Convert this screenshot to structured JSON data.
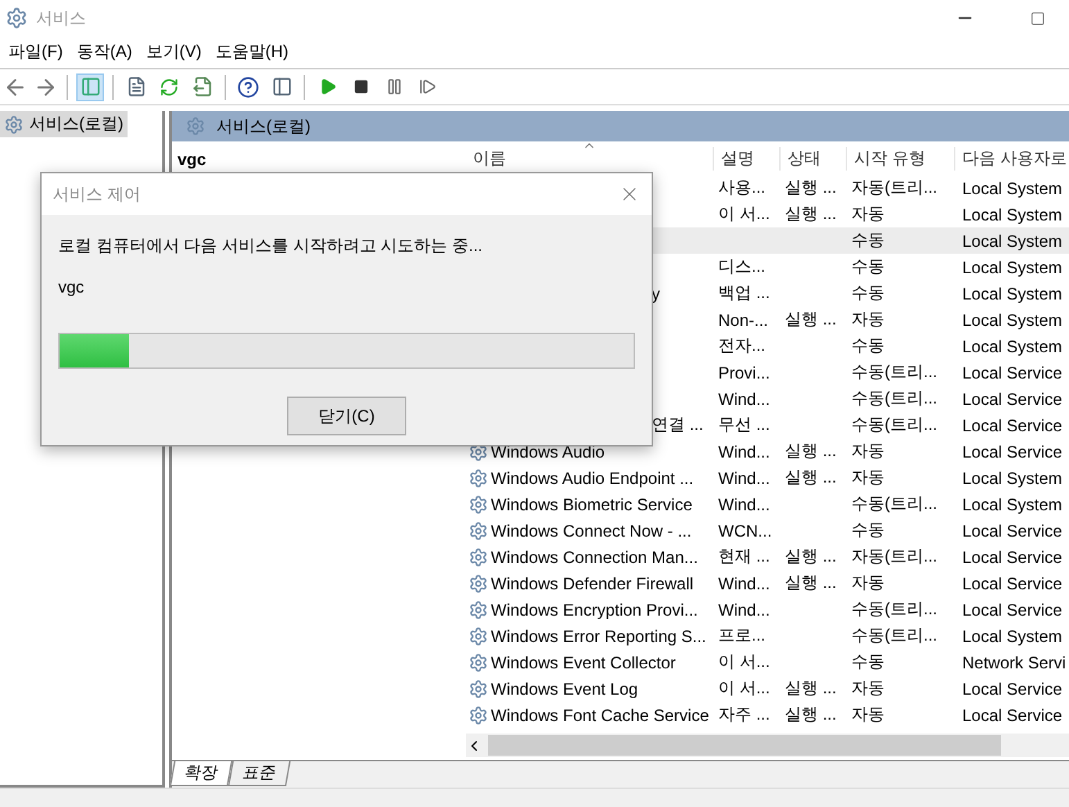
{
  "window": {
    "title": "서비스"
  },
  "menu": [
    "파일(F)",
    "동작(A)",
    "보기(V)",
    "도움말(H)"
  ],
  "tree": {
    "items": [
      {
        "label": "서비스(로컬)",
        "selected": true
      }
    ]
  },
  "pane": {
    "title": "서비스(로컬)",
    "service_name": "vgc"
  },
  "table": {
    "columns": [
      "이름",
      "설명",
      "상태",
      "시작 유형",
      "다음 사용자로"
    ],
    "rows": [
      {
        "cells": [
          "",
          "사용...",
          "실행 ...",
          "자동(트리...",
          "Local System"
        ],
        "selected": false
      },
      {
        "cells": [
          "",
          "이 서...",
          "실행 ...",
          "자동",
          "Local System"
        ],
        "selected": false
      },
      {
        "cells": [
          "",
          "",
          "",
          "수동",
          "Local System"
        ],
        "selected": true
      },
      {
        "cells": [
          "",
          "디스...",
          "",
          "수동",
          "Local System"
        ],
        "selected": false
      },
      {
        "covered": true,
        "cells": [
          "y",
          "백업 ...",
          "",
          "수동",
          "Local System"
        ],
        "selected": false
      },
      {
        "cells": [
          "",
          "Non-...",
          "실행 ...",
          "자동",
          "Local System"
        ],
        "selected": false
      },
      {
        "cells": [
          "",
          "전자...",
          "",
          "수동",
          "Local System"
        ],
        "selected": false
      },
      {
        "cells": [
          "",
          "Provi...",
          "",
          "수동(트리...",
          "Local Service"
        ],
        "selected": false
      },
      {
        "cells": [
          "",
          "Wind...",
          "",
          "수동(트리...",
          "Local Service"
        ],
        "selected": false
      },
      {
        "covered": true,
        "cells": [
          "연결 ...",
          "무선 ...",
          "",
          "수동(트리...",
          "Local Service"
        ],
        "selected": false
      },
      {
        "covered": false,
        "cells": [
          "Windows Audio",
          "Wind...",
          "실행 ...",
          "자동",
          "Local Service"
        ],
        "selected": false
      },
      {
        "covered": false,
        "cells": [
          "Windows Audio Endpoint ...",
          "Wind...",
          "실행 ...",
          "자동",
          "Local System"
        ],
        "selected": false
      },
      {
        "covered": false,
        "cells": [
          "Windows Biometric Service",
          "Wind...",
          "",
          "수동(트리...",
          "Local System"
        ],
        "selected": false
      },
      {
        "covered": false,
        "cells": [
          "Windows Connect Now - ...",
          "WCN...",
          "",
          "수동",
          "Local Service"
        ],
        "selected": false
      },
      {
        "covered": false,
        "cells": [
          "Windows Connection Man...",
          "현재 ...",
          "실행 ...",
          "자동(트리...",
          "Local Service"
        ],
        "selected": false
      },
      {
        "covered": false,
        "cells": [
          "Windows Defender Firewall",
          "Wind...",
          "실행 ...",
          "자동",
          "Local Service"
        ],
        "selected": false
      },
      {
        "covered": false,
        "cells": [
          "Windows Encryption Provi...",
          "Wind...",
          "",
          "수동(트리...",
          "Local Service"
        ],
        "selected": false
      },
      {
        "covered": false,
        "cells": [
          "Windows Error Reporting S...",
          "프로...",
          "",
          "수동(트리...",
          "Local System"
        ],
        "selected": false
      },
      {
        "covered": false,
        "cells": [
          "Windows Event Collector",
          "이 서...",
          "",
          "수동",
          "Network Servi"
        ],
        "selected": false
      },
      {
        "covered": false,
        "cells": [
          "Windows Event Log",
          "이 서...",
          "실행 ...",
          "자동",
          "Local Service"
        ],
        "selected": false
      },
      {
        "covered": false,
        "cells": [
          "Windows Font Cache Service",
          "자주 ...",
          "실행 ...",
          "자동",
          "Local Service"
        ],
        "selected": false
      }
    ]
  },
  "view_tabs": [
    {
      "label": "확장",
      "selected": true
    },
    {
      "label": "표준",
      "selected": false
    }
  ],
  "dialog": {
    "title": "서비스 제어",
    "message": "로컬 컴퓨터에서 다음 서비스를 시작하려고 시도하는 중...",
    "service": "vgc",
    "progress": {
      "level": 0.12
    },
    "button": "닫기(C)"
  }
}
